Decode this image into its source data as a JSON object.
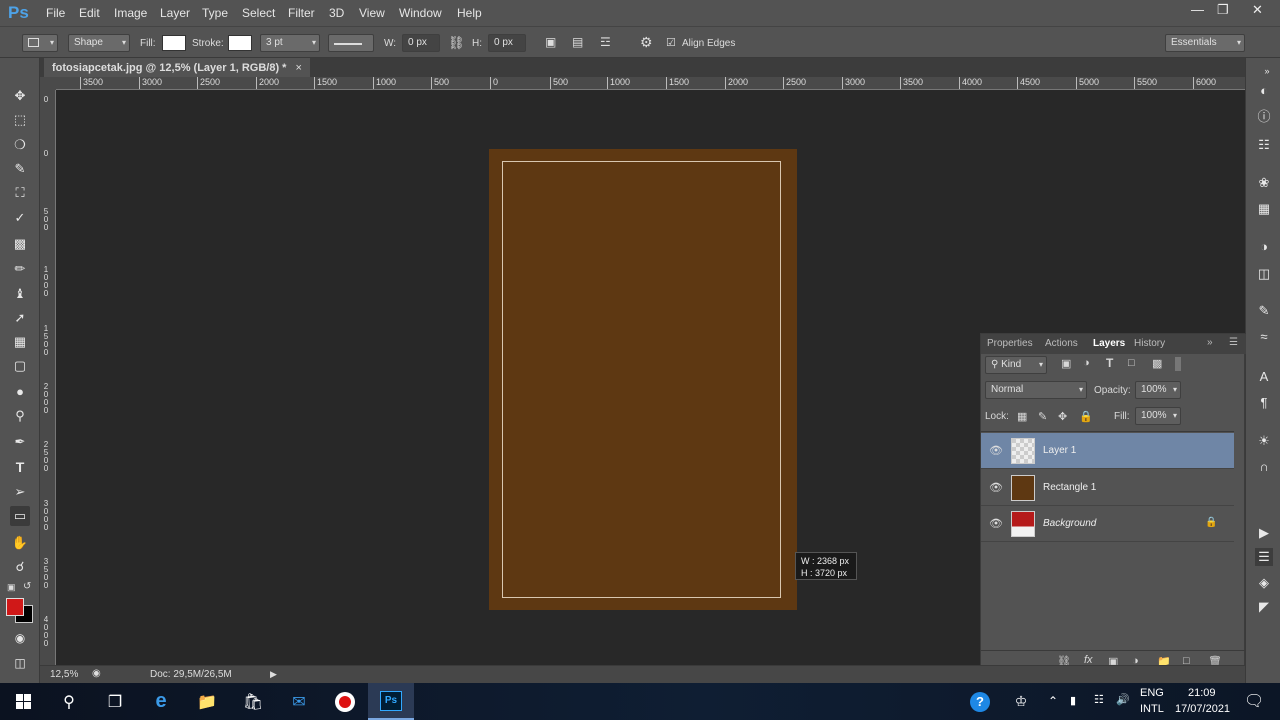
{
  "menubar": {
    "logo": "Ps",
    "items": [
      "File",
      "Edit",
      "Image",
      "Layer",
      "Type",
      "Select",
      "Filter",
      "3D",
      "View",
      "Window",
      "Help"
    ]
  },
  "options": {
    "shape_mode": "Shape",
    "fill_label": "Fill:",
    "stroke_label": "Stroke:",
    "stroke_size": "3 pt",
    "w_label": "W:",
    "w_value": "0 px",
    "h_label": "H:",
    "h_value": "0 px",
    "align_edges": "Align Edges",
    "workspace": "Essentials"
  },
  "document": {
    "tab_title": "fotosiapcetak.jpg @ 12,5% (Layer 1, RGB/8) *",
    "ruler_h": [
      "3500",
      "3000",
      "2500",
      "2000",
      "1500",
      "1000",
      "500",
      "0",
      "500",
      "1000",
      "1500",
      "2000",
      "2500",
      "3000",
      "3500",
      "4000",
      "4500",
      "5000",
      "5500",
      "6000"
    ],
    "ruler_v": [
      "0",
      "0",
      "5 0 0",
      "1 0 0 0",
      "1 5 0 0",
      "2 0 0 0",
      "2 5 0 0",
      "3 0 0 0",
      "3 5 0 0",
      "4 0 0 0"
    ],
    "doc_color": "#5e3812",
    "tooltip_w": "W :  2368 px",
    "tooltip_h": "H :  3720 px"
  },
  "status": {
    "zoom": "12,5%",
    "doc_size": "Doc: 29,5M/26,5M"
  },
  "panel": {
    "tabs": [
      "Properties",
      "Actions",
      "Layers",
      "History"
    ],
    "active_tab": "Layers",
    "kind_label": "Kind",
    "blend_mode": "Normal",
    "opacity_label": "Opacity:",
    "opacity_value": "100%",
    "lock_label": "Lock:",
    "fill_label": "Fill:",
    "fill_value": "100%",
    "layers": [
      {
        "name": "Layer 1",
        "selected": true
      },
      {
        "name": "Rectangle 1",
        "selected": false
      },
      {
        "name": "Background",
        "selected": false,
        "locked": true
      }
    ]
  },
  "colors": {
    "foreground": "#d01818",
    "background": "#000000",
    "selected_layer": "#6f86a6"
  },
  "taskbar": {
    "lang": "ENG",
    "lang_sub": "INTL",
    "time": "21:09",
    "date": "17/07/2021"
  }
}
